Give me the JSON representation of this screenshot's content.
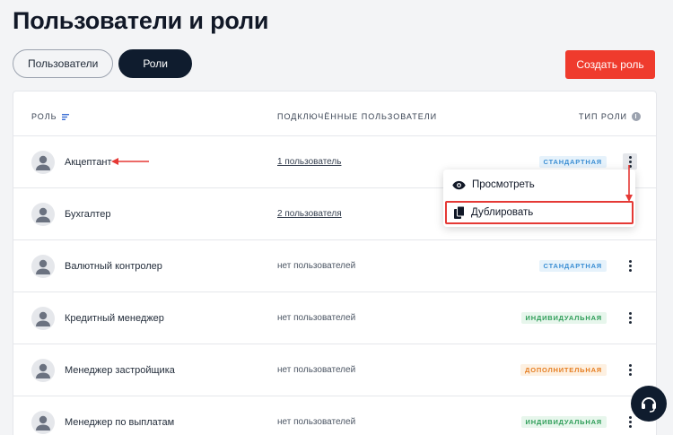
{
  "page_title": "Пользователи и роли",
  "tabs": [
    {
      "label": "Пользователи",
      "active": false
    },
    {
      "label": "Роли",
      "active": true
    }
  ],
  "create_button": "Создать роль",
  "table": {
    "headers": {
      "role": "Роль",
      "users": "Подключённые пользователи",
      "type": "Тип роли"
    },
    "rows": [
      {
        "name": "Акцептант",
        "users": "1 пользователь",
        "users_is_link": true,
        "type": "Стандартная",
        "type_kind": "standard"
      },
      {
        "name": "Бухгалтер",
        "users": "2 пользователя",
        "users_is_link": true,
        "type": "",
        "type_kind": ""
      },
      {
        "name": "Валютный контролер",
        "users": "нет пользователей",
        "users_is_link": false,
        "type": "Стандартная",
        "type_kind": "standard"
      },
      {
        "name": "Кредитный менеджер",
        "users": "нет пользователей",
        "users_is_link": false,
        "type": "Индивидуальная",
        "type_kind": "individual"
      },
      {
        "name": "Менеджер застройщика",
        "users": "нет пользователей",
        "users_is_link": false,
        "type": "Дополнительная",
        "type_kind": "additional"
      },
      {
        "name": "Менеджер по выплатам",
        "users": "нет пользователей",
        "users_is_link": false,
        "type": "Индивидуальная",
        "type_kind": "individual"
      }
    ]
  },
  "context_menu": {
    "items": [
      {
        "label": "Просмотреть",
        "icon": "eye-icon"
      },
      {
        "label": "Дублировать",
        "icon": "copy-icon",
        "highlighted": true
      }
    ]
  },
  "colors": {
    "accent_red": "#ef3b2d",
    "dark_navy": "#0f1c2e",
    "annotation_red": "#e53935"
  }
}
